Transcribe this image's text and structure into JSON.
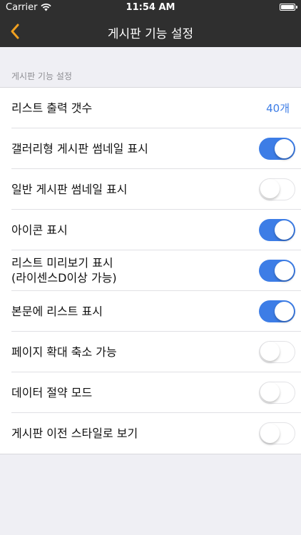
{
  "status_bar": {
    "carrier": "Carrier",
    "time": "11:54 AM"
  },
  "nav": {
    "title": "게시판 기능 설정",
    "back_icon": "chevron-left-icon"
  },
  "section": {
    "header": "게시판 기능 설정"
  },
  "settings": [
    {
      "label": "리스트 출력 갯수",
      "value": "40개"
    },
    {
      "label": "갤러리형 게시판 썸네일 표시",
      "toggle": true
    },
    {
      "label": "일반 게시판 썸네일 표시",
      "toggle": false
    },
    {
      "label": "아이콘 표시",
      "toggle": true
    },
    {
      "label": "리스트 미리보기 표시",
      "label_line2": "(라이센스D이상 가능)",
      "toggle": true
    },
    {
      "label": "본문에 리스트 표시",
      "toggle": true
    },
    {
      "label": "페이지 확대 축소 가능",
      "toggle": false
    },
    {
      "label": "데이터 절약 모드",
      "toggle": false
    },
    {
      "label": "게시판 이전 스타일로 보기",
      "toggle": false
    }
  ],
  "colors": {
    "nav_background": "#2f2f2f",
    "accent": "#3d7de6",
    "back_chevron": "#f0a020",
    "page_background": "#efeff4"
  }
}
